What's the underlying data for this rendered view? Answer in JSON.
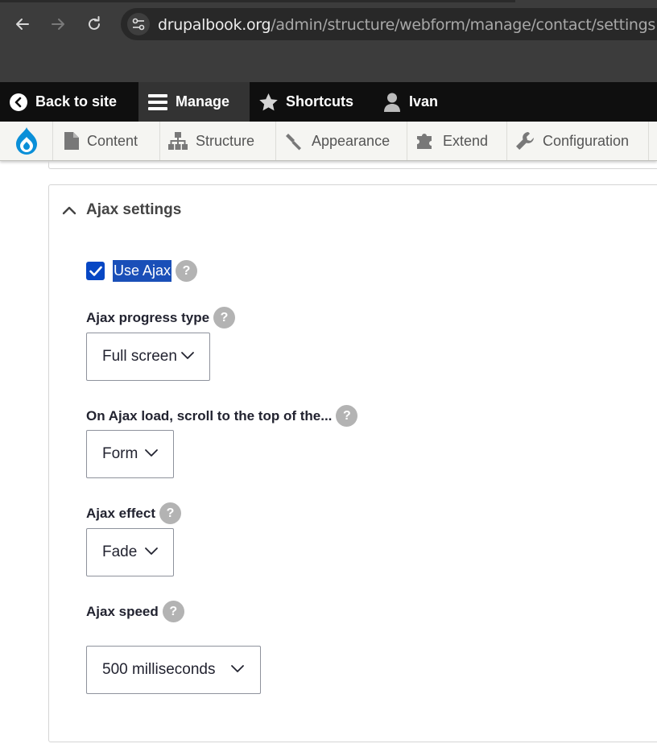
{
  "browser": {
    "url_host": "drupalbook.org",
    "url_path": "/admin/structure/webform/manage/contact/settings",
    "back_icon": "arrow-left-icon",
    "forward_icon": "arrow-right-icon",
    "reload_icon": "reload-icon",
    "site_info_icon": "tune-icon"
  },
  "toolbar": {
    "back_to_site": "Back to site",
    "manage": "Manage",
    "shortcuts": "Shortcuts",
    "user": "Ivan"
  },
  "tray": {
    "items": [
      "Content",
      "Structure",
      "Appearance",
      "Extend",
      "Configuration"
    ]
  },
  "ajax": {
    "title": "Ajax settings",
    "use_ajax_label": "Use Ajax",
    "use_ajax_checked": true,
    "help_glyph": "?",
    "progress_type_label": "Ajax progress type",
    "progress_type_value": "Full screen",
    "scroll_label": "On Ajax load, scroll to the top of the...",
    "scroll_value": "Form",
    "effect_label": "Ajax effect",
    "effect_value": "Fade",
    "speed_label": "Ajax speed",
    "speed_value": "500 milliseconds"
  },
  "colors": {
    "accent": "#0747c4",
    "toolbar_dark": "#0f0f0f",
    "tray_bg": "#f5f5f2",
    "help_badge": "#b3b3b3"
  }
}
